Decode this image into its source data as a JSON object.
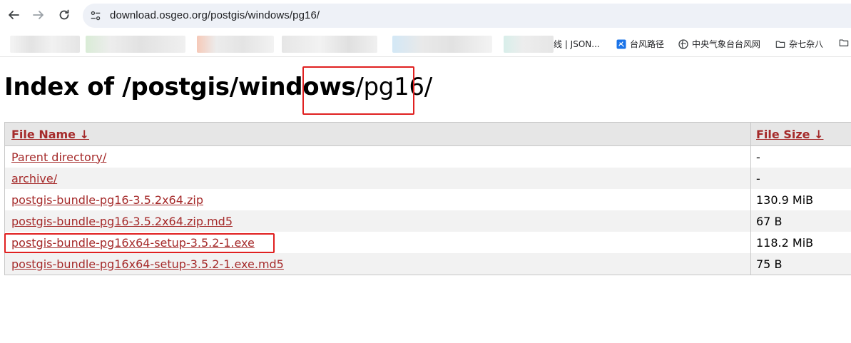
{
  "browser": {
    "url": "download.osgeo.org/postgis/windows/pg16/",
    "bookmarks": [
      {
        "label": "线 | JSON..."
      },
      {
        "label": "台风路径",
        "icon": "typhoon-icon"
      },
      {
        "label": "中央气象台台风网",
        "icon": "globe-icon"
      },
      {
        "label": "杂七杂八",
        "icon": "folder-icon"
      }
    ]
  },
  "page": {
    "title_main": "Index of /postgis/windows",
    "title_tail": "/pg16/",
    "table": {
      "col_name": "File Name  ↓",
      "col_size": "File Size  ↓",
      "rows": [
        {
          "name": "Parent directory/",
          "size": "-"
        },
        {
          "name": "archive/",
          "size": "-"
        },
        {
          "name": "postgis-bundle-pg16-3.5.2x64.zip",
          "size": "130.9 MiB"
        },
        {
          "name": "postgis-bundle-pg16-3.5.2x64.zip.md5",
          "size": "67 B"
        },
        {
          "name": "postgis-bundle-pg16x64-setup-3.5.2-1.exe",
          "size": "118.2 MiB"
        },
        {
          "name": "postgis-bundle-pg16x64-setup-3.5.2-1.exe.md5",
          "size": "75 B"
        }
      ]
    }
  },
  "colors": {
    "link": "#a52a2a",
    "highlight": "#e02020",
    "header_bg": "#e6e6e6",
    "alt_row_bg": "#f2f2f2"
  }
}
